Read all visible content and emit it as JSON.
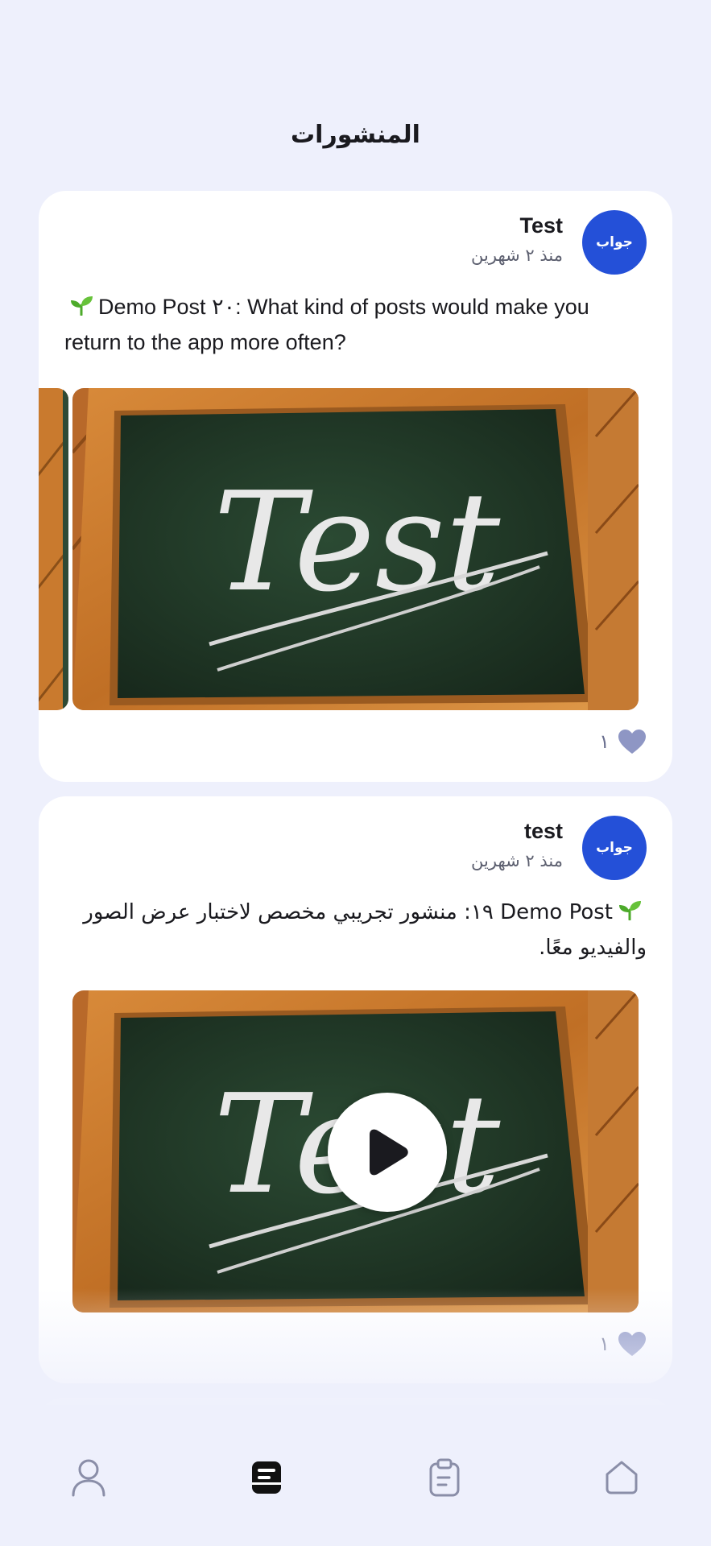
{
  "header": {
    "title": "المنشورات"
  },
  "posts": [
    {
      "author": "Test",
      "avatar_text": "جواب",
      "time": "منذ ٢ شهرين",
      "text": "Demo Post ٢٠: What kind of posts would make you return to the app more often?",
      "media_image_text": "Test",
      "likes": "١",
      "like_icon": "heart-icon"
    },
    {
      "author": "test",
      "avatar_text": "جواب",
      "time": "منذ ٢ شهرين",
      "text": "Demo Post ١٩: منشور تجريبي مخصص لاختبار عرض الصور والفيديو معًا.",
      "media_image_text": "Test",
      "media_type": "video",
      "likes": "١",
      "like_icon": "heart-icon"
    }
  ],
  "nav": {
    "items": [
      {
        "name": "profile",
        "icon": "user-icon"
      },
      {
        "name": "posts",
        "icon": "posts-icon",
        "active": true
      },
      {
        "name": "tasks",
        "icon": "clipboard-icon"
      },
      {
        "name": "home",
        "icon": "home-icon"
      }
    ]
  },
  "colors": {
    "background": "#eef0fc",
    "avatar": "#2450d8",
    "heart": "#8e96c4",
    "nav_icon": "#8a8ea8",
    "nav_active": "#111111"
  }
}
